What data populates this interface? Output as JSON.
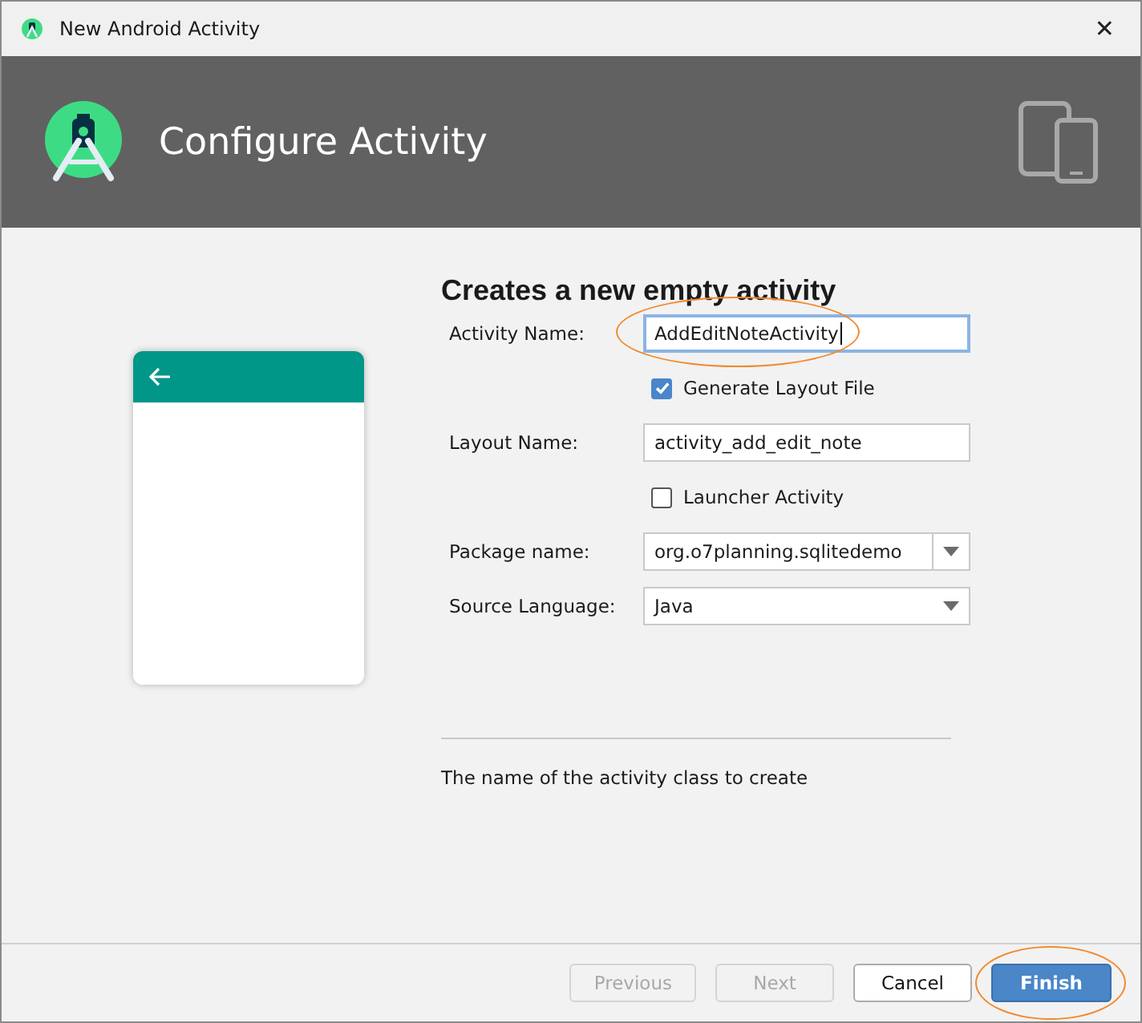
{
  "window": {
    "title": "New Android Activity",
    "close": "✕"
  },
  "header": {
    "title": "Configure Activity"
  },
  "form": {
    "heading": "Creates a new empty activity",
    "rows": [
      {
        "kind": "text",
        "label": "Activity Name:",
        "value": "AddEditNoteActivity",
        "focused": true,
        "highlighted": true
      },
      {
        "kind": "checkbox",
        "label": "Generate Layout File",
        "checked": true
      },
      {
        "kind": "text",
        "label": "Layout Name:",
        "value": "activity_add_edit_note",
        "focused": false,
        "highlighted": false
      },
      {
        "kind": "checkbox",
        "label": "Launcher Activity",
        "checked": false
      },
      {
        "kind": "combo",
        "label": "Package name:",
        "value": "org.o7planning.sqlitedemo"
      },
      {
        "kind": "select",
        "label": "Source Language:",
        "value": "Java"
      }
    ],
    "description": "The name of the activity class to create"
  },
  "buttons": [
    {
      "label": "Previous",
      "disabled": true,
      "primary": false,
      "highlighted": false
    },
    {
      "label": "Next",
      "disabled": true,
      "primary": false,
      "highlighted": false
    },
    {
      "label": "Cancel",
      "disabled": false,
      "primary": false,
      "highlighted": false
    },
    {
      "label": "Finish",
      "disabled": false,
      "primary": true,
      "highlighted": true
    }
  ]
}
